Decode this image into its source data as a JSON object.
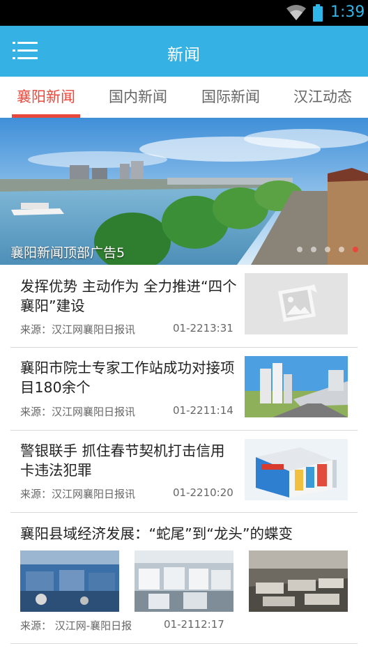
{
  "status_bar": {
    "time": "1:39",
    "icons": [
      "wifi-icon",
      "battery-icon"
    ]
  },
  "app_bar": {
    "title": "新闻",
    "menu_icon": "menu-icon"
  },
  "tabs": [
    {
      "label": "襄阳新闻",
      "active": true
    },
    {
      "label": "国内新闻",
      "active": false
    },
    {
      "label": "国际新闻",
      "active": false
    },
    {
      "label": "汉江动态",
      "active": false
    }
  ],
  "banner": {
    "caption": "襄阳新闻顶部广告5",
    "dot_count": 5,
    "active_dot": 5
  },
  "news": [
    {
      "title": "发挥优势 主动作为 全力推进“四个襄阳”建设",
      "source": "来源：汉江网襄阳日报讯",
      "time": "01-2213:31",
      "thumbnail": "image-placeholder-icon"
    },
    {
      "title": "襄阳市院士专家工作站成功对接项目180余个",
      "source": "来源：汉江网襄阳日报讯",
      "time": "01-2211:14",
      "thumbnail": "city-buildings-photo"
    },
    {
      "title": "警银联手 抓住春节契机打击信用卡违法犯罪",
      "source": "来源：汉江网襄阳日报讯",
      "time": "01-2210:20",
      "thumbnail": "bank-kiosk-photo"
    },
    {
      "title": "襄阳县域经济发展：“蛇尾”到“龙头”的蝶变",
      "source": "来源： 汉江网-襄阳日报",
      "time": "01-2112:17",
      "images": [
        "factory-photo",
        "factory-machines-photo",
        "factory-workshop-photo"
      ]
    }
  ],
  "colors": {
    "status_bar": "#000000",
    "app_bar": "#35b2e3",
    "accent": "#e8483b",
    "tab_inactive": "#666666",
    "divider": "#d8d8d8"
  }
}
